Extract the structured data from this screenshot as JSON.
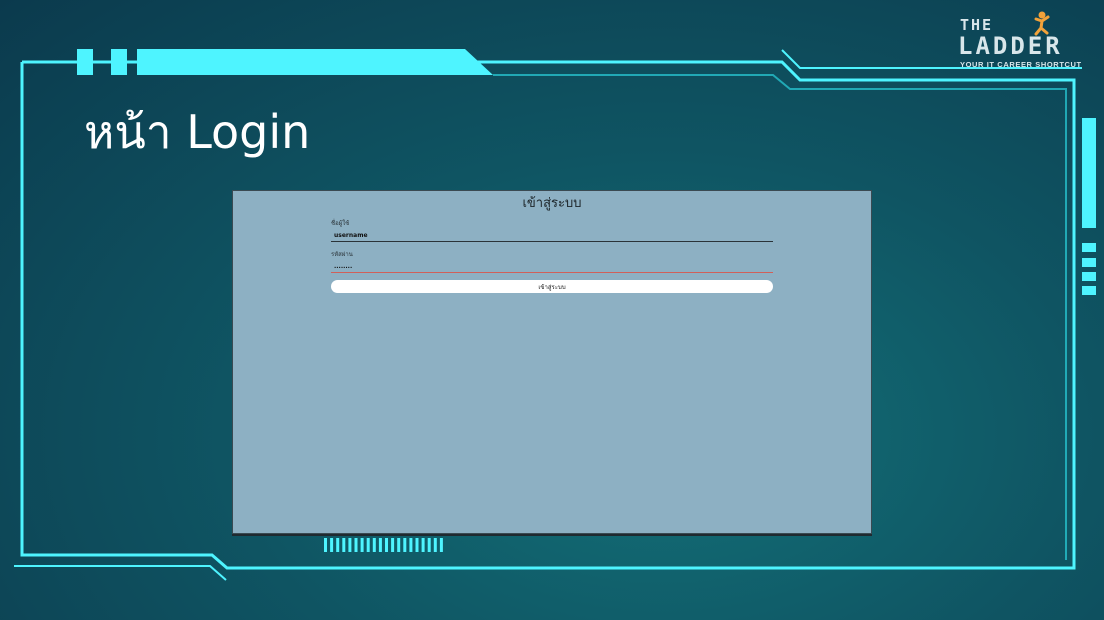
{
  "slide": {
    "title": "หน้า Login"
  },
  "logo": {
    "line1": "THE",
    "line2": "LADDER",
    "tagline": "YOUR IT CAREER SHORTCUT"
  },
  "login_form": {
    "heading": "เข้าสู่ระบบ",
    "username_label": "ชื่อผู้ใช้",
    "username_value": "username",
    "password_label": "รหัสผ่าน",
    "password_value": "........",
    "submit_label": "เข้าสู่ระบบ"
  },
  "colors": {
    "frame_accent": "#4ef4ff",
    "screen_bg": "#8db0c3",
    "background_dark": "#0b3a4d"
  }
}
